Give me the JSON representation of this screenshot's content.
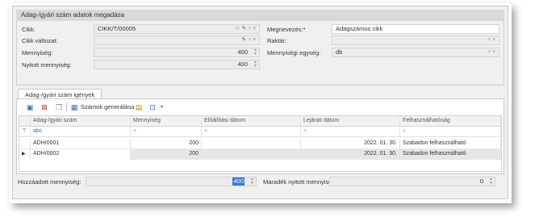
{
  "group_title": "Adag-/gyári szám adatok megadása",
  "form": {
    "cikk_label": "Cikk:",
    "cikk_value": "CIKK/T/00005",
    "cikk_valtozat_label": "Cikk változat:",
    "cikk_valtozat_value": "",
    "mennyiseg_label": "Mennyiség:",
    "mennyiseg_value": "400",
    "nyitott_label": "Nyitott mennyiség:",
    "nyitott_value": "400",
    "megnevezes_label": "Megnevezés:*",
    "megnevezes_value": "Adagszámos cikk",
    "raktar_label": "Raktár:",
    "raktar_value": "",
    "egyseg_label": "Mennyiségi egység:",
    "egyseg_value": "db"
  },
  "tab": {
    "label": "Adag-/gyári szám igények"
  },
  "toolbar": {
    "generate_label": "Számok generálása",
    "icons": [
      "add-icon",
      "delete-icon",
      "copy-icon",
      "generate-icon",
      "excel-icon",
      "export-icon",
      "dropdown-icon"
    ]
  },
  "grid": {
    "columns": [
      "Adag-/gyári szám",
      "Mennyiség",
      "Előállítási dátum",
      "Lejárati dátum",
      "Felhasználhatóság"
    ],
    "filter_symbols": [
      "abc",
      "=",
      "=",
      "=",
      "="
    ],
    "rows": [
      [
        "ADH/0001",
        "200",
        "",
        "2022. 01. 30.",
        "Szabadon felhasználható"
      ],
      [
        "ADH/0002",
        "200",
        "",
        "2022. 01. 30.",
        "Szabadon felhasználható"
      ]
    ]
  },
  "footer": {
    "hozzaadott_label": "Hozzáadott mennyiség:",
    "hozzaadott_value": "400",
    "maradek_label": "Maradék nyitott mennyiség:",
    "maradek_value": "0"
  },
  "colors": {
    "accent": "#3a6fb7",
    "selection": "#3a78d4"
  }
}
